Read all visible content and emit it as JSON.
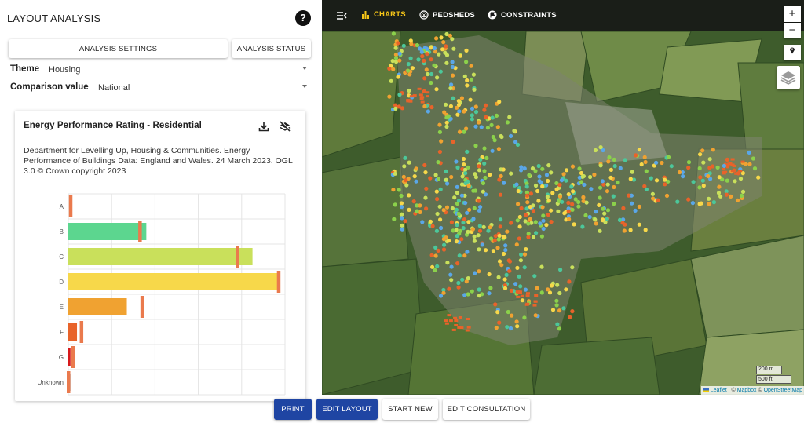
{
  "app": {
    "title": "LAYOUT ANALYSIS"
  },
  "panel": {
    "settings_button": "ANALYSIS SETTINGS",
    "status_button": "ANALYSIS STATUS",
    "theme_label": "Theme",
    "theme_value": "Housing",
    "comparison_label": "Comparison value",
    "comparison_value": "National"
  },
  "card": {
    "title": "Energy Performance Rating - Residential",
    "source": "Department for Levelling Up, Housing & Communities. Energy Performance of Buildings Data: England and Wales. 24 March 2023. OGL 3.0 © Crown copyright 2023"
  },
  "chart_data": {
    "type": "bar",
    "orientation": "horizontal",
    "categories": [
      "A",
      "B",
      "C",
      "D",
      "E",
      "F",
      "G",
      "Unknown"
    ],
    "series": [
      {
        "values": [
          0,
          36,
          85,
          97,
          27,
          4,
          1,
          1
        ],
        "color_by_category": [
          "#31a354",
          "#5cd68f",
          "#c9e05b",
          "#f7d84a",
          "#f0a231",
          "#e8632a",
          "#d7191c",
          "#999999"
        ]
      },
      {
        "values": [
          1,
          33,
          78,
          97,
          34,
          6,
          2,
          0
        ],
        "marker": "comparison",
        "color": "#ea7a4d"
      }
    ],
    "xlim": [
      0,
      100
    ],
    "grid": true
  },
  "map": {
    "nav": {
      "charts": "CHARTS",
      "pedsheds": "PEDSHEDS",
      "constraints": "CONSTRAINTS"
    },
    "zoom_in": "+",
    "zoom_out": "−",
    "scale_metric": "200 m",
    "scale_imperial": "500 ft",
    "attribution": {
      "leaflet": "Leaflet",
      "sep1": " | © ",
      "mapbox": "Mapbox",
      "sep2": " © ",
      "osm": "OpenStreetMap"
    }
  },
  "actions": {
    "print": "PRINT",
    "edit_layout": "EDIT LAYOUT",
    "start_new": "START NEW",
    "edit_consultation": "EDIT CONSULTATION"
  },
  "colors": {
    "primary": "#1f45a3",
    "nav_active": "#f5c518",
    "comparison_marker": "#ea7a4d"
  }
}
